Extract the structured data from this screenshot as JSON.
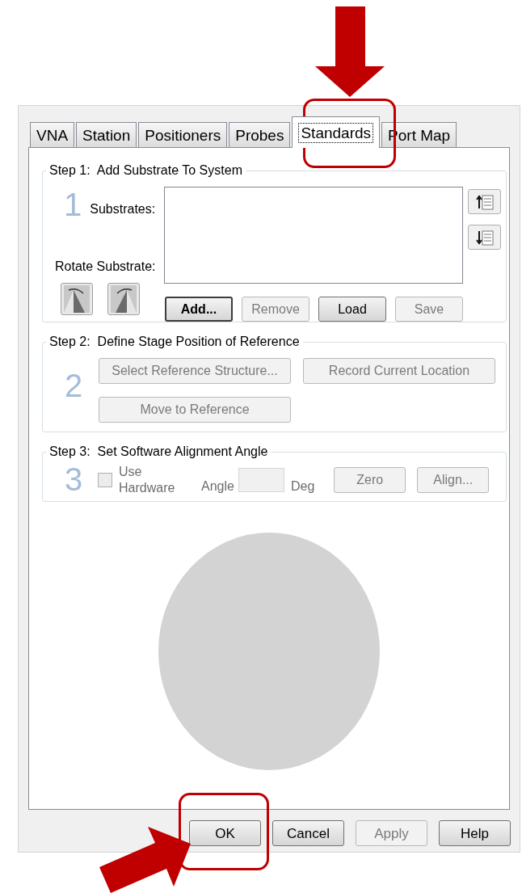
{
  "tabs": [
    {
      "label": "VNA",
      "selected": false
    },
    {
      "label": "Station",
      "selected": false
    },
    {
      "label": "Positioners",
      "selected": false
    },
    {
      "label": "Probes",
      "selected": false
    },
    {
      "label": "Standards",
      "selected": true
    },
    {
      "label": "Port Map",
      "selected": false
    }
  ],
  "step1": {
    "title": "Step 1:  Add Substrate To System",
    "number": "1",
    "substrates_label": "Substrates:",
    "rotate_label": "Rotate Substrate:",
    "buttons": [
      {
        "label": "Add...",
        "default": true,
        "disabled": false
      },
      {
        "label": "Remove",
        "default": false,
        "disabled": true
      },
      {
        "label": "Load",
        "default": false,
        "disabled": false
      },
      {
        "label": "Save",
        "default": false,
        "disabled": true
      }
    ]
  },
  "step2": {
    "title": "Step 2:  Define Stage Position of Reference",
    "number": "2",
    "buttons": [
      {
        "label": "Select Reference Structure...",
        "disabled": true
      },
      {
        "label": "Record Current Location",
        "disabled": true
      },
      {
        "label": "Move to Reference",
        "disabled": true
      }
    ]
  },
  "step3": {
    "title": "Step 3:  Set Software Alignment Angle",
    "number": "3",
    "use_hardware": {
      "label": "Use Hardware",
      "checked": false,
      "disabled": true
    },
    "angle_label": "Angle",
    "angle_field": {
      "disabled": true
    },
    "unit": "Deg",
    "buttons": [
      {
        "label": "Zero",
        "disabled": true
      },
      {
        "label": "Align...",
        "disabled": true
      }
    ]
  },
  "dialog_buttons": [
    {
      "label": "OK",
      "disabled": false
    },
    {
      "label": "Cancel",
      "disabled": false
    },
    {
      "label": "Apply",
      "disabled": true
    },
    {
      "label": "Help",
      "disabled": false
    }
  ]
}
